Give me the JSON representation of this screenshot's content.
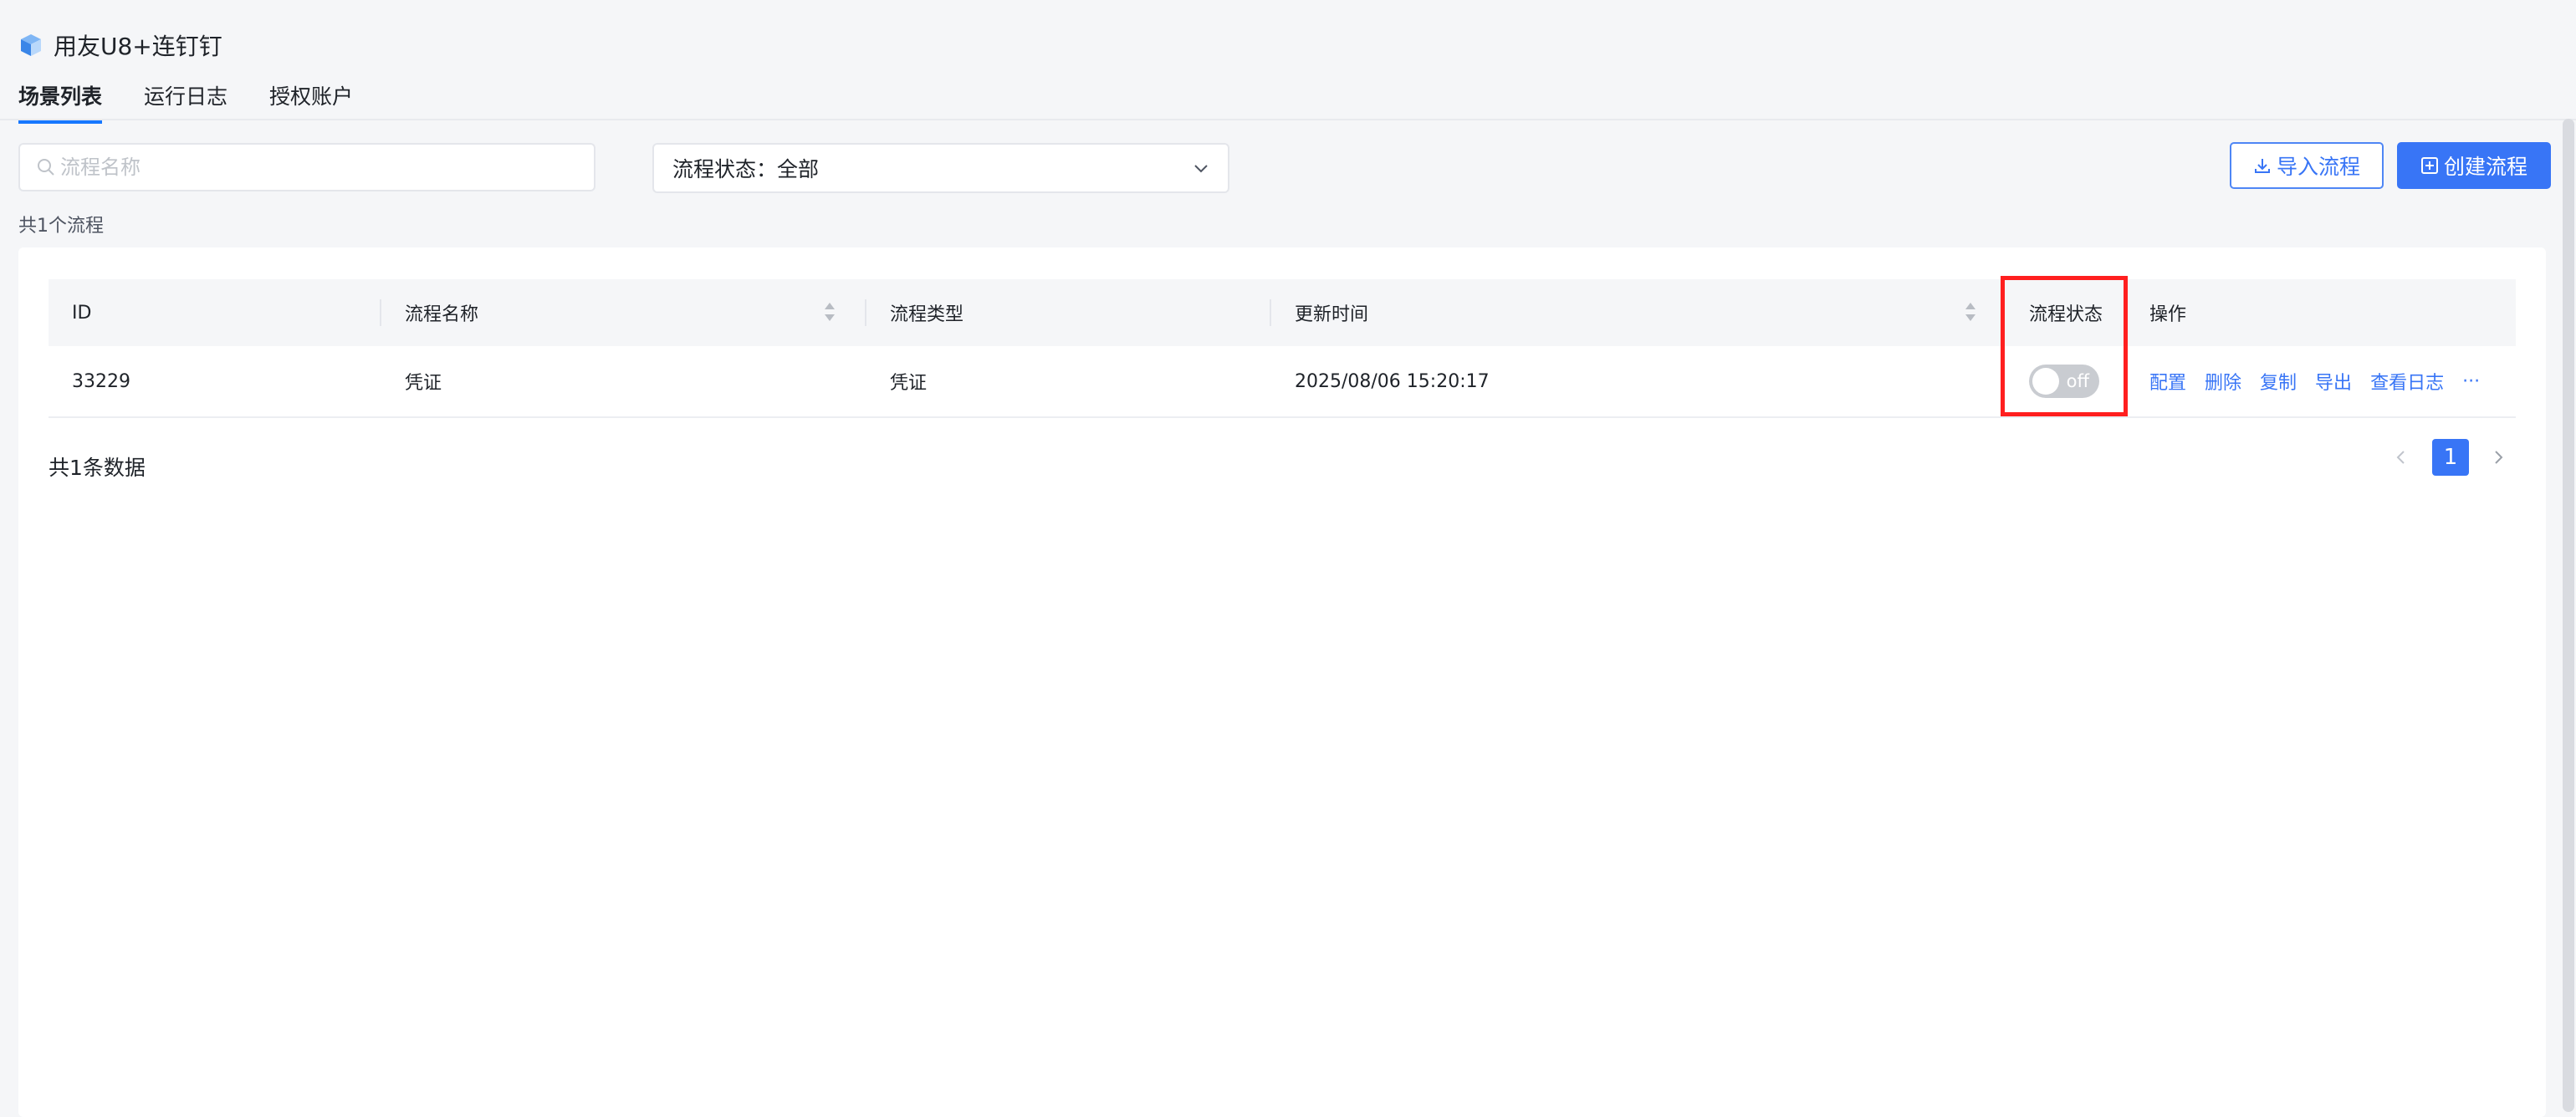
{
  "app": {
    "title": "用友U8+连钉钉"
  },
  "tabs": [
    {
      "label": "场景列表",
      "active": true
    },
    {
      "label": "运行日志",
      "active": false
    },
    {
      "label": "授权账户",
      "active": false
    }
  ],
  "search": {
    "placeholder": "流程名称",
    "value": ""
  },
  "status_filter": {
    "label": "流程状态：全部"
  },
  "buttons": {
    "import": "导入流程",
    "create": "创建流程"
  },
  "summary": {
    "flow_count": "共1个流程"
  },
  "table": {
    "columns": {
      "id": "ID",
      "name": "流程名称",
      "type": "流程类型",
      "updated": "更新时间",
      "status": "流程状态",
      "actions": "操作"
    },
    "rows": [
      {
        "id": "33229",
        "name": "凭证",
        "type": "凭证",
        "updated": "2025/08/06 15:20:17",
        "status_label": "off",
        "status_on": false,
        "actions": [
          "配置",
          "删除",
          "复制",
          "导出",
          "查看日志",
          "···"
        ]
      }
    ]
  },
  "pagination": {
    "total": "共1条数据",
    "current_page": "1"
  },
  "colors": {
    "accent": "#3875f6",
    "highlight": "#ff1f1f",
    "toggle_off": "#c9ccd1"
  },
  "icons": {
    "logo": "cube-logo-icon",
    "search": "search-icon",
    "chevron": "chevron-down-icon",
    "import": "download-icon",
    "create": "plus-square-icon",
    "sort": "sort-icon"
  }
}
